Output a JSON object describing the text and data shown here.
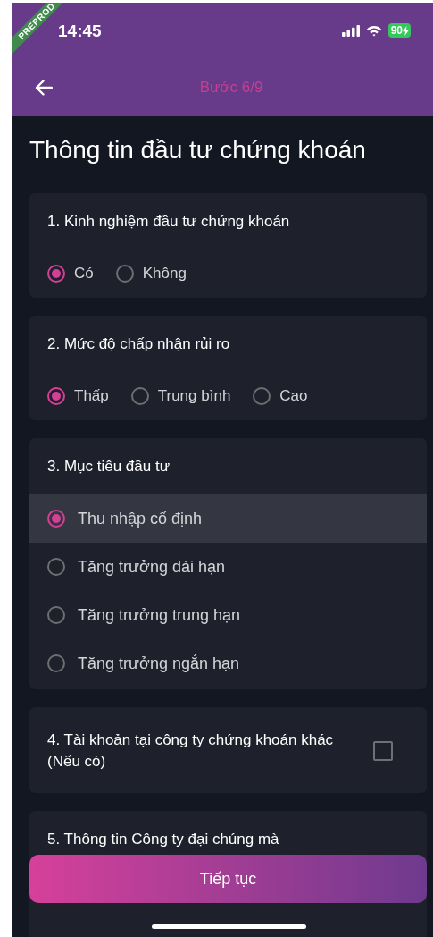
{
  "status_bar": {
    "time": "14:45",
    "battery": "90"
  },
  "banner": "PREPROD",
  "app_bar": {
    "title": "Bước 6/9"
  },
  "page_title": "Thông tin đầu tư chứng khoán",
  "questions": [
    {
      "kind": "radio_inline",
      "label": "1. Kinh nghiệm đầu tư chứng khoán",
      "options": [
        {
          "label": "Có",
          "selected": true
        },
        {
          "label": "Không",
          "selected": false
        }
      ]
    },
    {
      "kind": "radio_inline",
      "label": "2. Mức độ chấp nhận rủi ro",
      "options": [
        {
          "label": "Thấp",
          "selected": true
        },
        {
          "label": "Trung bình",
          "selected": false
        },
        {
          "label": "Cao",
          "selected": false
        }
      ]
    },
    {
      "kind": "radio_list",
      "label": "3. Mục tiêu đầu tư",
      "options": [
        {
          "label": "Thu nhập cố định",
          "selected": true
        },
        {
          "label": "Tăng trưởng dài hạn",
          "selected": false
        },
        {
          "label": "Tăng trưởng trung hạn",
          "selected": false
        },
        {
          "label": "Tăng trưởng ngắn hạn",
          "selected": false
        }
      ]
    },
    {
      "kind": "checkbox",
      "label": "4. Tài khoản tại công ty chứng khoán khác (Nếu có)",
      "checked": false
    },
    {
      "kind": "text",
      "label": "5. Thông tin Công ty đại chúng mà"
    }
  ],
  "button": "Tiếp tục"
}
